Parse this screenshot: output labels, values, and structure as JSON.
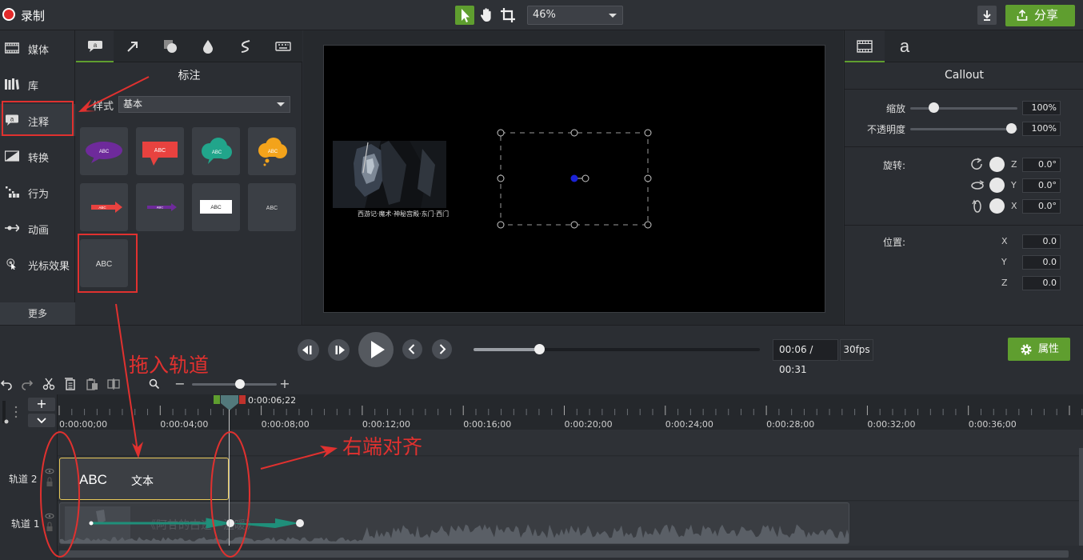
{
  "topbar": {
    "record_label": "录制",
    "zoom_value": "46%",
    "share_label": "分享"
  },
  "leftnav": {
    "items": [
      {
        "label": "媒体",
        "icon": "film-icon"
      },
      {
        "label": "库",
        "icon": "library-icon"
      },
      {
        "label": "注释",
        "icon": "callout-icon"
      },
      {
        "label": "转换",
        "icon": "transition-icon"
      },
      {
        "label": "行为",
        "icon": "behavior-icon"
      },
      {
        "label": "动画",
        "icon": "animation-icon"
      },
      {
        "label": "光标效果",
        "icon": "cursor-effect-icon"
      }
    ],
    "more_label": "更多"
  },
  "callout_panel": {
    "title": "标注",
    "style_label": "样式",
    "style_value": "基本",
    "tiles": [
      "ABC",
      "ABC",
      "ABC",
      "ABC",
      "ABC",
      "ABC",
      "ABC",
      "ABC",
      "ABC"
    ]
  },
  "preview": {
    "thumb_caption": "西游记·魔术·神秘宫殿·东门·西门"
  },
  "properties": {
    "title": "Callout",
    "scale_label": "缩放",
    "scale_value": "100%",
    "opacity_label": "不透明度",
    "opacity_value": "100%",
    "rotation_label": "旋转:",
    "rotation": {
      "z": "0.0°",
      "y": "0.0°",
      "x": "0.0°"
    },
    "position_label": "位置:",
    "position": {
      "x": "0.0",
      "y": "0.0",
      "z": "0.0"
    },
    "axis": {
      "x": "X",
      "y": "Y",
      "z": "Z"
    }
  },
  "playback": {
    "timecode": "00:06 / 00:31",
    "fps": "30fps",
    "properties_button": "属性",
    "progress": 0.23
  },
  "timeline": {
    "playhead_time": "0:00:06;22",
    "ruler_labels": [
      "0:00:00;00",
      "0:00:04;00",
      "0:00:08;00",
      "0:00:12;00",
      "0:00:16;00",
      "0:00:20;00",
      "0:00:24;00",
      "0:00:28;00",
      "0:00:32;00",
      "0:00:36;00"
    ],
    "tracks": [
      {
        "name": "轨道 2",
        "clip_title": "ABC",
        "clip_subtitle": "文本"
      },
      {
        "name": "轨道 1",
        "clip_text": "《阿甘的古迹—温暖》"
      }
    ]
  },
  "annotations": {
    "drag_to_track": "拖入轨道",
    "align_right": "右端对齐"
  },
  "colors": {
    "accent_green": "#5f9e2f",
    "record_red": "#e32a2a",
    "annotation_red": "#e0312f",
    "clip_border": "#e8c95a"
  }
}
